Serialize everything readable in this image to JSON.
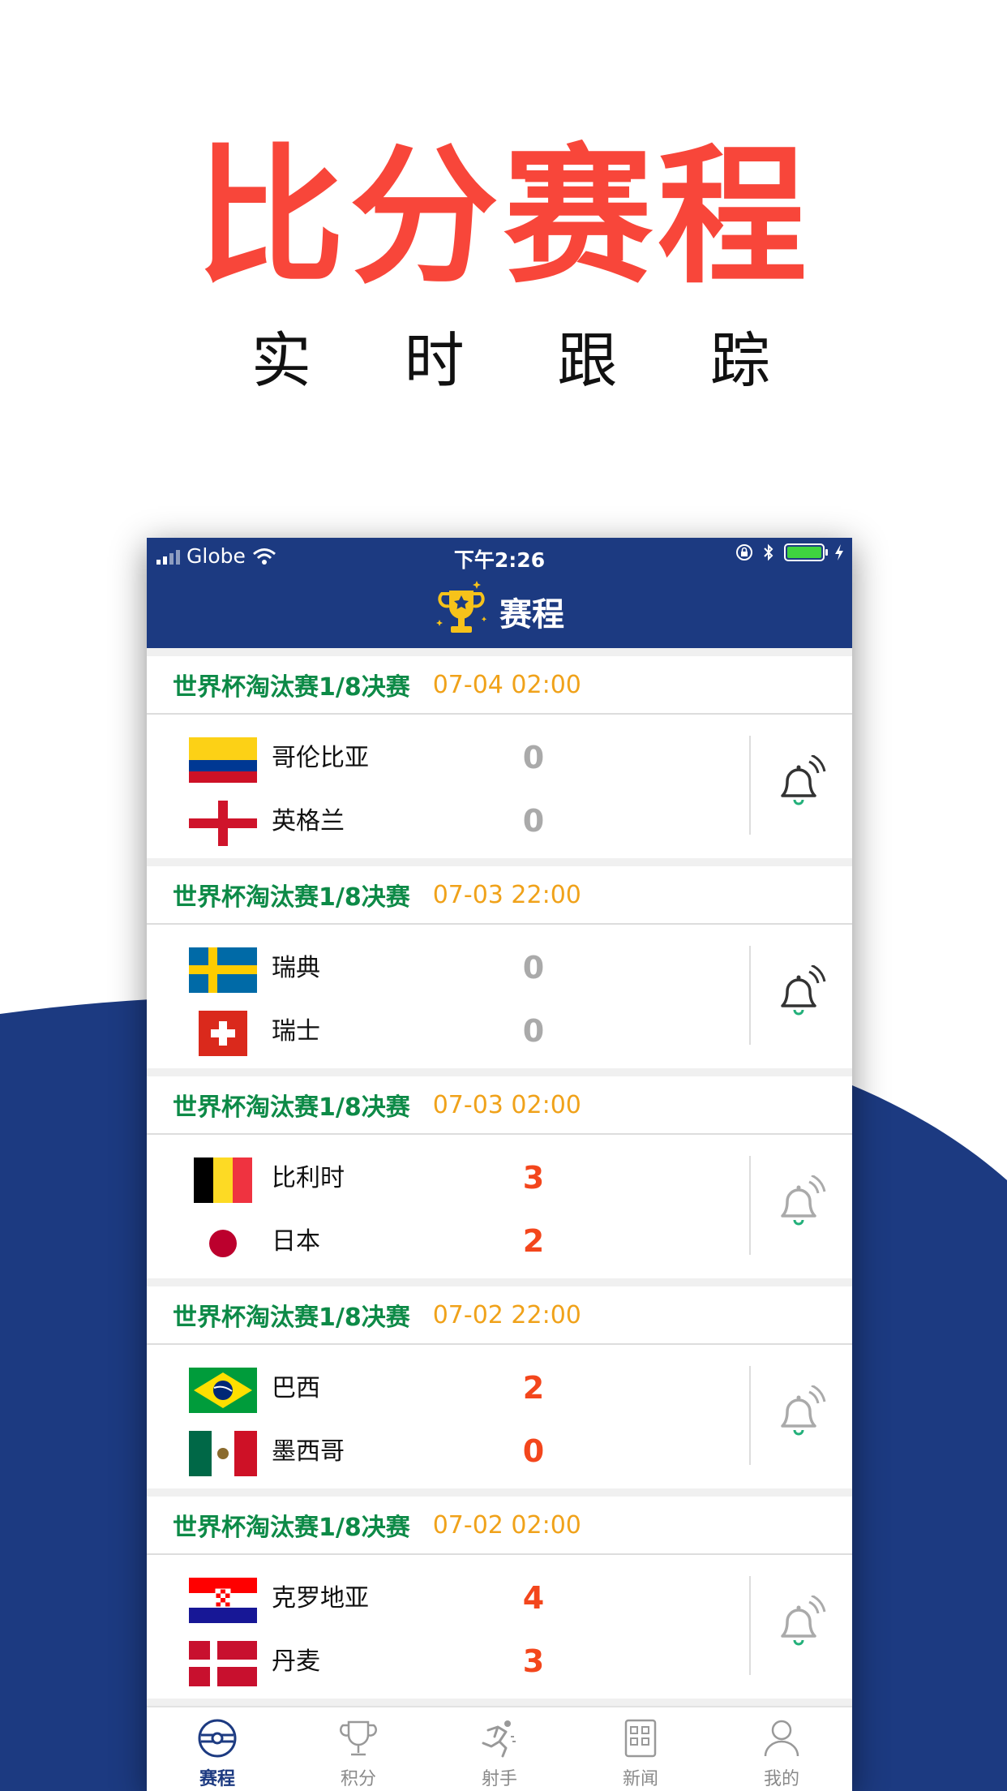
{
  "promo": {
    "title": "比分赛程",
    "subtitle": [
      "实",
      "时",
      "跟",
      "踪"
    ]
  },
  "colors": {
    "accent_red": "#f8463a",
    "navy": "#1c3a81",
    "green": "#0d8a47",
    "orange": "#f0a21a",
    "score_red": "#f3461c"
  },
  "statusbar": {
    "carrier": "Globe",
    "time": "下午2:26",
    "battery": 1.0
  },
  "nav": {
    "title": "赛程",
    "icon": "trophy-icon"
  },
  "matches": [
    {
      "competition": "世界杯淘汰赛1/8决赛",
      "time": "07-04 02:00",
      "home": {
        "name": "哥伦比亚",
        "score": "0",
        "flag": "colombia"
      },
      "away": {
        "name": "英格兰",
        "score": "0",
        "flag": "england"
      },
      "status": "pending",
      "reminder": "bell-icon"
    },
    {
      "competition": "世界杯淘汰赛1/8决赛",
      "time": "07-03 22:00",
      "home": {
        "name": "瑞典",
        "score": "0",
        "flag": "sweden"
      },
      "away": {
        "name": "瑞士",
        "score": "0",
        "flag": "switzerland"
      },
      "status": "pending",
      "reminder": "bell-icon"
    },
    {
      "competition": "世界杯淘汰赛1/8决赛",
      "time": "07-03 02:00",
      "home": {
        "name": "比利时",
        "score": "3",
        "flag": "belgium"
      },
      "away": {
        "name": "日本",
        "score": "2",
        "flag": "japan"
      },
      "status": "final",
      "reminder": "bell-icon"
    },
    {
      "competition": "世界杯淘汰赛1/8决赛",
      "time": "07-02 22:00",
      "home": {
        "name": "巴西",
        "score": "2",
        "flag": "brazil"
      },
      "away": {
        "name": "墨西哥",
        "score": "0",
        "flag": "mexico"
      },
      "status": "final",
      "reminder": "bell-icon"
    },
    {
      "competition": "世界杯淘汰赛1/8决赛",
      "time": "07-02 02:00",
      "home": {
        "name": "克罗地亚",
        "score": "4",
        "flag": "croatia"
      },
      "away": {
        "name": "丹麦",
        "score": "3",
        "flag": "denmark"
      },
      "status": "final",
      "reminder": "bell-icon"
    }
  ],
  "tabs": [
    {
      "label": "赛程",
      "icon": "football-icon",
      "active": true
    },
    {
      "label": "积分",
      "icon": "trophy-outline-icon",
      "active": false
    },
    {
      "label": "射手",
      "icon": "runner-icon",
      "active": false
    },
    {
      "label": "新闻",
      "icon": "news-icon",
      "active": false
    },
    {
      "label": "我的",
      "icon": "user-icon",
      "active": false
    }
  ]
}
